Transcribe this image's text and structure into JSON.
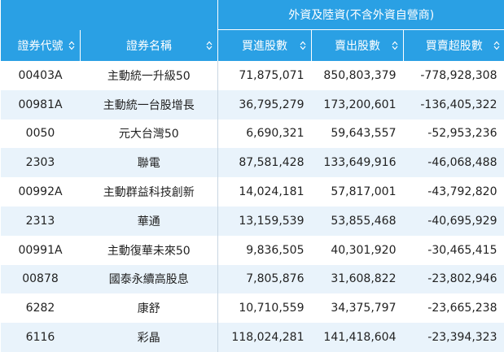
{
  "header": {
    "group_label": "外資及陸資(不含外資自營商)",
    "columns": [
      {
        "label": "證券代號"
      },
      {
        "label": "證券名稱"
      },
      {
        "label": "買進股數"
      },
      {
        "label": "賣出股數"
      },
      {
        "label": "買賣超股數"
      }
    ]
  },
  "rows": [
    {
      "code": "00403A",
      "name": "主動統一升級50",
      "buy": "71,875,071",
      "sell": "850,803,379",
      "net": "-778,928,308"
    },
    {
      "code": "00981A",
      "name": "主動統一台股增長",
      "buy": "36,795,279",
      "sell": "173,200,601",
      "net": "-136,405,322"
    },
    {
      "code": "0050",
      "name": "元大台灣50",
      "buy": "6,690,321",
      "sell": "59,643,557",
      "net": "-52,953,236"
    },
    {
      "code": "2303",
      "name": "聯電",
      "buy": "87,581,428",
      "sell": "133,649,916",
      "net": "-46,068,488"
    },
    {
      "code": "00992A",
      "name": "主動群益科技創新",
      "buy": "14,024,181",
      "sell": "57,817,001",
      "net": "-43,792,820"
    },
    {
      "code": "2313",
      "name": "華通",
      "buy": "13,159,539",
      "sell": "53,855,468",
      "net": "-40,695,929"
    },
    {
      "code": "00991A",
      "name": "主動復華未來50",
      "buy": "9,836,505",
      "sell": "40,301,920",
      "net": "-30,465,415"
    },
    {
      "code": "00878",
      "name": "國泰永續高股息",
      "buy": "7,805,876",
      "sell": "31,608,822",
      "net": "-23,802,946"
    },
    {
      "code": "6282",
      "name": "康舒",
      "buy": "10,710,559",
      "sell": "34,375,797",
      "net": "-23,665,238"
    },
    {
      "code": "6116",
      "name": "彩晶",
      "buy": "118,024,281",
      "sell": "141,418,604",
      "net": "-23,394,323"
    }
  ],
  "icons": {
    "sort": "sort-icon"
  },
  "colors": {
    "header_bg": "#2aa0e4",
    "header_text": "#ffffff",
    "row_alt_bg": "#e9f3fb"
  }
}
